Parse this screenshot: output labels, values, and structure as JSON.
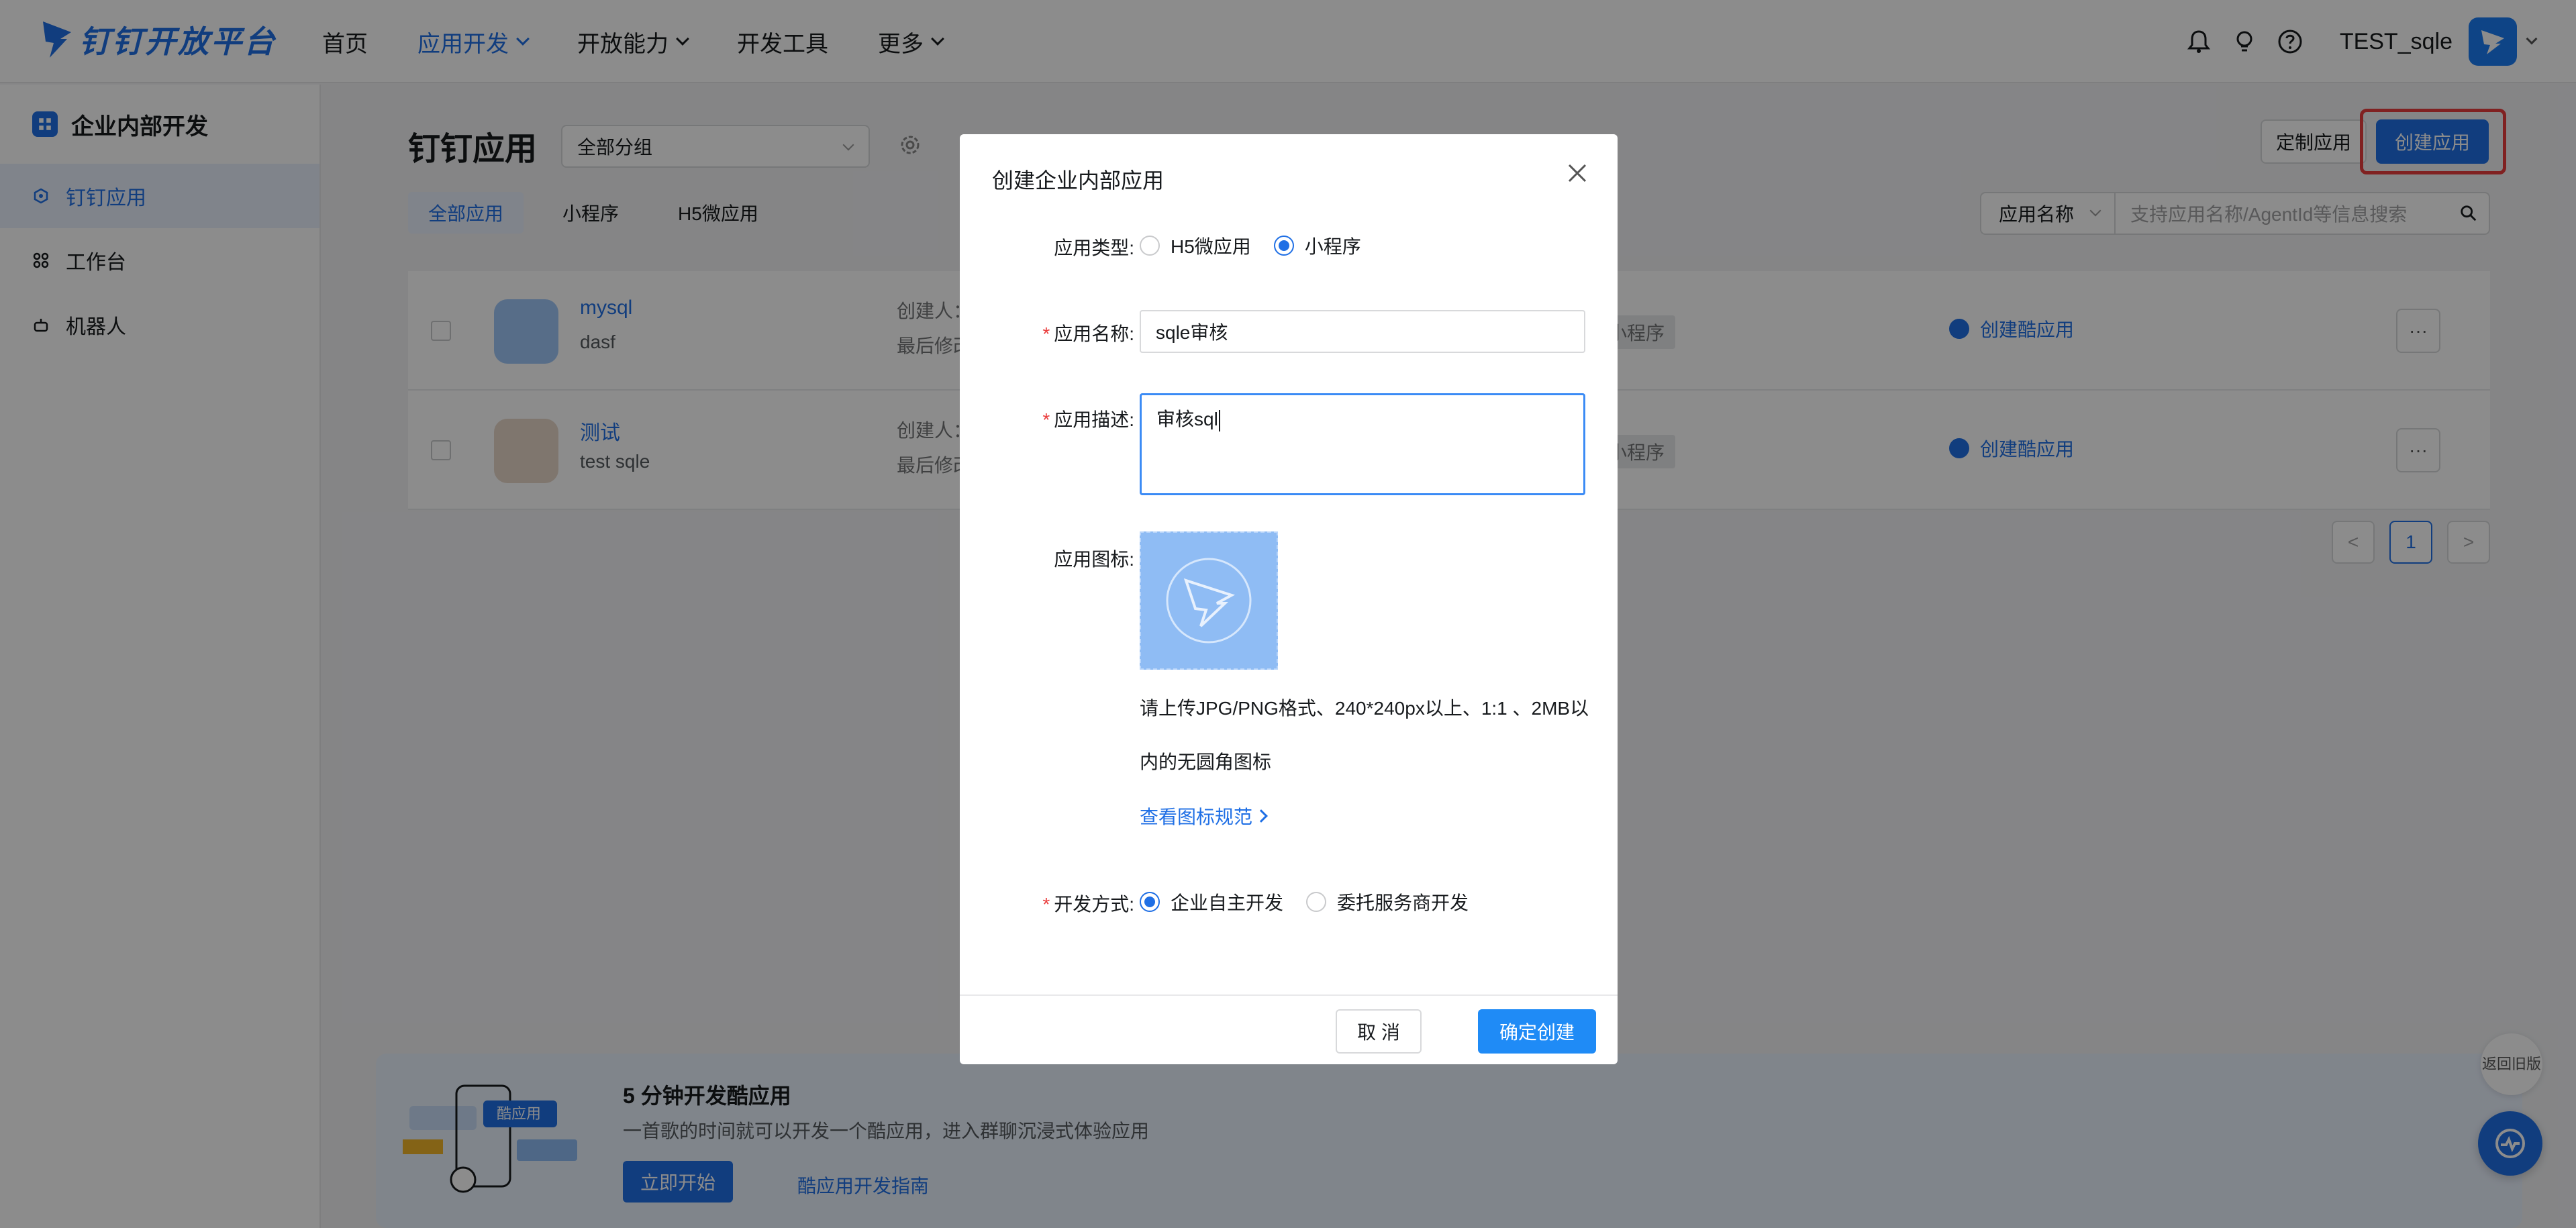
{
  "brand": {
    "name": "钉钉开放平台",
    "color": "#1f6fe5"
  },
  "nav": {
    "items": [
      {
        "label": "首页"
      },
      {
        "label": "应用开发"
      },
      {
        "label": "开放能力"
      },
      {
        "label": "开发工具"
      },
      {
        "label": "更多"
      }
    ],
    "active": "应用开发"
  },
  "top_right": {
    "icons": [
      "bell-icon",
      "lightbulb-icon",
      "help-icon"
    ],
    "user_name": "TEST_sqle"
  },
  "sidebar": {
    "title": "企业内部开发",
    "items": [
      {
        "label": "钉钉应用",
        "icon": "cube-icon"
      },
      {
        "label": "工作台",
        "icon": "grid-icon"
      },
      {
        "label": "机器人",
        "icon": "robot-icon"
      }
    ],
    "active": "钉钉应用"
  },
  "main": {
    "title": "钉钉应用",
    "group_select": "全部分组",
    "custom_button": "定制应用",
    "create_button": "创建应用",
    "tabs": [
      {
        "label": "全部应用"
      },
      {
        "label": "小程序"
      },
      {
        "label": "H5微应用"
      }
    ],
    "search": {
      "field": "应用名称",
      "placeholder": "支持应用名称/AgentId等信息搜索"
    },
    "rows": [
      {
        "name": "mysql",
        "desc": "dasf",
        "meta1": "创建人：",
        "meta2": "最后修改",
        "type": "小程序",
        "action": "创建酷应用",
        "more": "···"
      },
      {
        "name": "测试",
        "desc": "test sqle",
        "meta1": "创建人：",
        "meta2": "最后修改",
        "type": "小程序",
        "action": "创建酷应用",
        "more": "···"
      }
    ],
    "pagination": {
      "prev": "<",
      "page": "1",
      "next": ">"
    }
  },
  "banner": {
    "badge": "酷应用",
    "title": "5 分钟开发酷应用",
    "subtitle": "一首歌的时间就可以开发一个酷应用，进入群聊沉浸式体验应用",
    "start_button": "立即开始",
    "guide_link": "酷应用开发指南"
  },
  "floating": {
    "back_old": "返回旧版"
  },
  "modal": {
    "title": "创建企业内部应用",
    "type_label": "应用类型:",
    "type_options": [
      {
        "label": "H5微应用",
        "selected": false
      },
      {
        "label": "小程序",
        "selected": true
      }
    ],
    "name_label": "应用名称:",
    "name_value": "sqle审核",
    "desc_label": "应用描述:",
    "desc_value": "审核sql",
    "icon_label": "应用图标:",
    "icon_hint": "请上传JPG/PNG格式、240*240px以上、1:1 、2MB以内的无圆角图标",
    "icon_spec_link": "查看图标规范",
    "dev_label": "开发方式:",
    "dev_options": [
      {
        "label": "企业自主开发",
        "selected": true
      },
      {
        "label": "委托服务商开发",
        "selected": false
      }
    ],
    "cancel": "取 消",
    "confirm": "确定创建"
  }
}
